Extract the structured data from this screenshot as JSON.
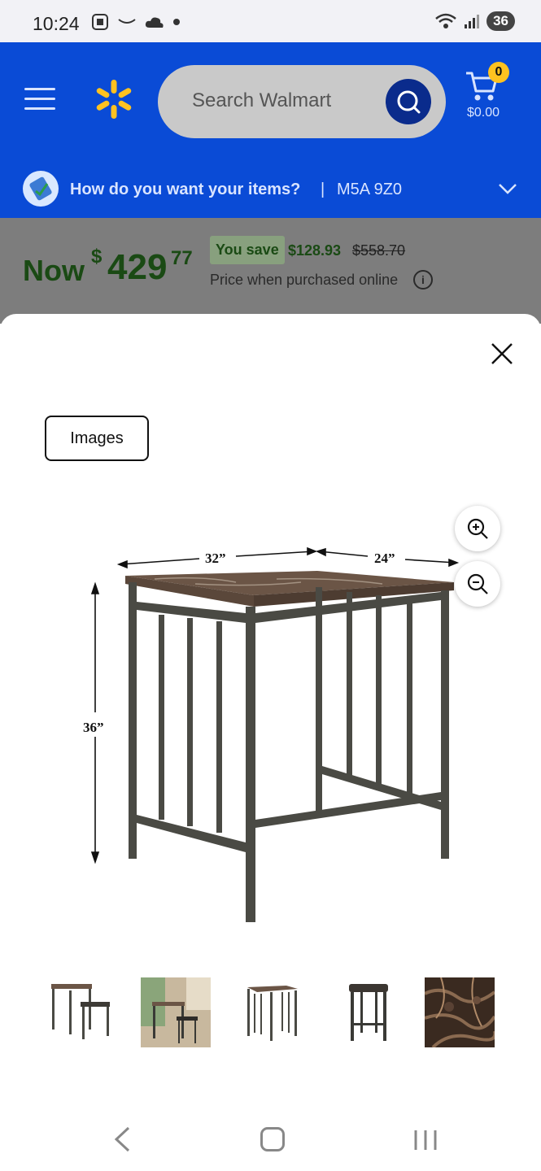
{
  "status_bar": {
    "time": "10:24",
    "battery": "36"
  },
  "header": {
    "search_placeholder": "Search Walmart",
    "cart_count": "0",
    "cart_total": "$0.00",
    "brand_color": "#0a4bd6",
    "spark_color": "#ffc220"
  },
  "delivery": {
    "question": "How do you want your items?",
    "separator": "|",
    "postal_code": "M5A 9Z0"
  },
  "price": {
    "now_label": "Now",
    "currency": "$",
    "dollars": "429",
    "cents": "77",
    "save_label": "You save",
    "save_amount": "$128.93",
    "was_price": "$558.70",
    "note": "Price when purchased online",
    "info_glyph": "i"
  },
  "viewer": {
    "tab_label": "Images",
    "dim_width": "32”",
    "dim_depth": "24”",
    "dim_height": "36”",
    "thumbnails": [
      {
        "name": "thumb-table-set"
      },
      {
        "name": "thumb-room-scene"
      },
      {
        "name": "thumb-table"
      },
      {
        "name": "thumb-stool"
      },
      {
        "name": "thumb-marble-texture"
      }
    ]
  }
}
